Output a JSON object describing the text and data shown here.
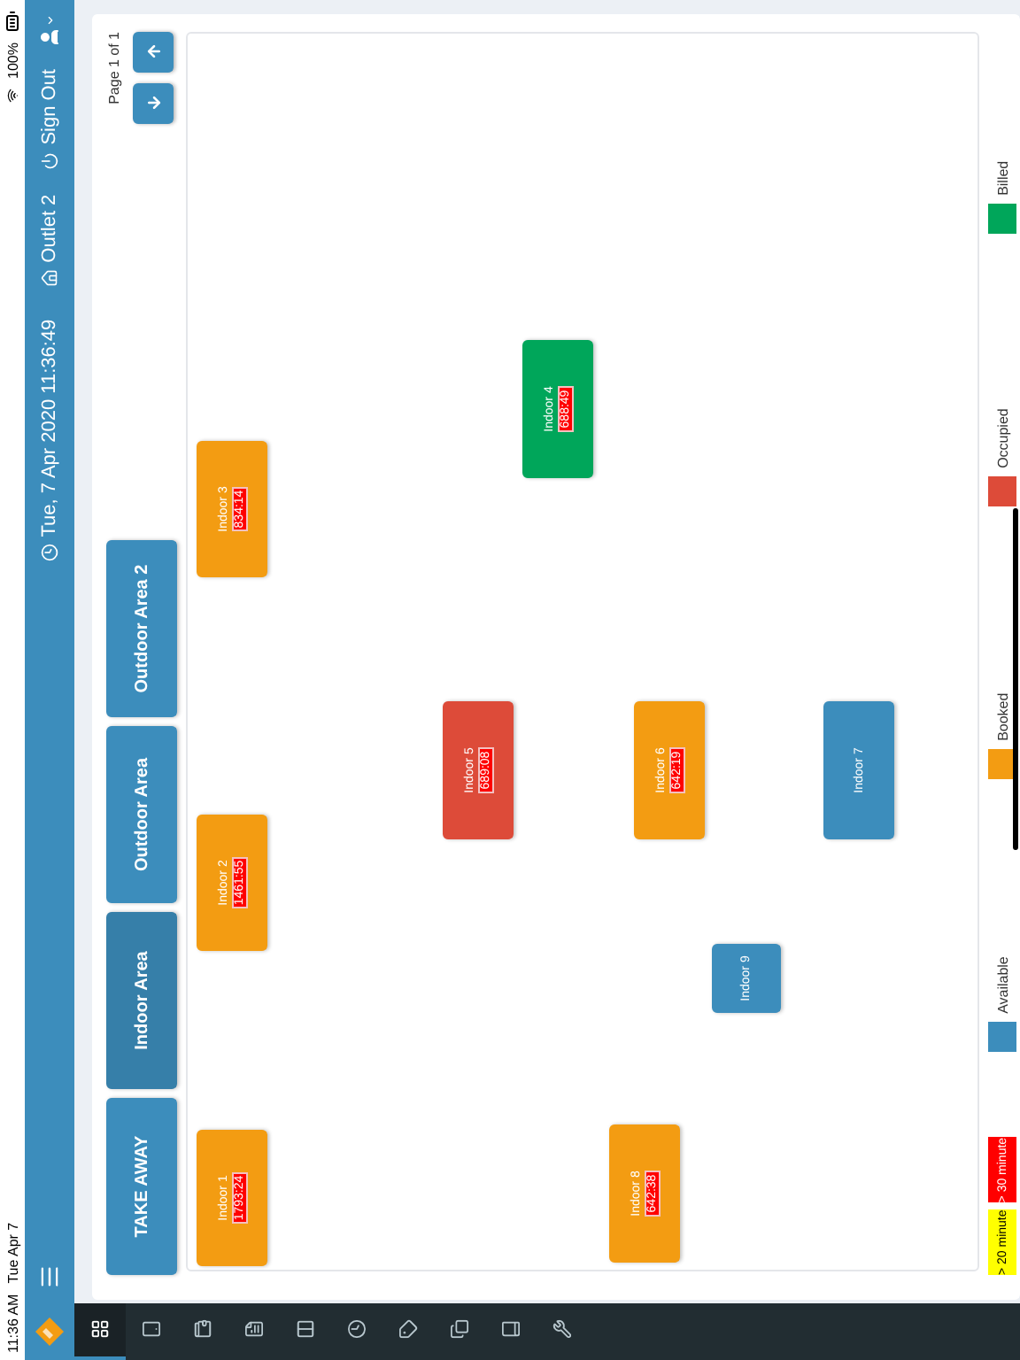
{
  "status_bar": {
    "time": "11:36 AM",
    "date": "Tue Apr 7",
    "battery": "100%"
  },
  "header": {
    "datetime": "Tue, 7 Apr 2020 11:36:49",
    "outlet": "Outlet 2",
    "sign_out": "Sign Out"
  },
  "toolbar": [
    {
      "kind": "grid",
      "selected": true
    },
    {
      "kind": "tablet",
      "selected": false
    },
    {
      "kind": "wallet",
      "selected": false
    },
    {
      "kind": "file",
      "selected": false
    },
    {
      "kind": "columns",
      "selected": false
    },
    {
      "kind": "clock",
      "selected": false
    },
    {
      "kind": "tag",
      "selected": false
    },
    {
      "kind": "copy",
      "selected": false
    },
    {
      "kind": "book",
      "selected": false
    },
    {
      "kind": "wrench",
      "selected": false
    }
  ],
  "areas": [
    {
      "label": "TAKE AWAY",
      "selected": false
    },
    {
      "label": "Indoor Area",
      "selected": true
    },
    {
      "label": "Outdoor Area",
      "selected": false
    },
    {
      "label": "Outdoor Area 2",
      "selected": false
    }
  ],
  "pagination": {
    "label": "Page 1 of 1"
  },
  "tables": [
    {
      "name": "Indoor 1",
      "color": "#f39c12",
      "timer": "1793:24"
    },
    {
      "name": "Indoor 2",
      "color": "#f39c12",
      "timer": "1461:55"
    },
    {
      "name": "Indoor 3",
      "color": "#f39c12",
      "timer": "834:14"
    },
    {
      "name": "Indoor 4",
      "color": "#00a65a",
      "timer": "688:49"
    },
    {
      "name": "Indoor 5",
      "color": "#dd4b39",
      "timer": "689:08"
    },
    {
      "name": "Indoor 6",
      "color": "#f39c12",
      "timer": "642:19"
    },
    {
      "name": "Indoor 7",
      "color": "#3c8dbc"
    },
    {
      "name": "Indoor 8",
      "color": "#f39c12",
      "timer": "642:38"
    },
    {
      "name": "Indoor 9",
      "color": "#3c8dbc"
    }
  ],
  "legend": [
    {
      "label": "> 20 minute",
      "kind": "bar",
      "color": "#ffff00"
    },
    {
      "label": "> 30 minute",
      "kind": "bar",
      "color": "#ff0000"
    },
    {
      "label": "Available",
      "kind": "swatch",
      "color": "#3c8dbc"
    },
    {
      "label": "Booked",
      "kind": "swatch",
      "color": "#f39c12"
    },
    {
      "label": "Occupied",
      "kind": "swatch",
      "color": "#dd4b39"
    },
    {
      "label": "Billed",
      "kind": "swatch",
      "color": "#00a65a"
    }
  ]
}
